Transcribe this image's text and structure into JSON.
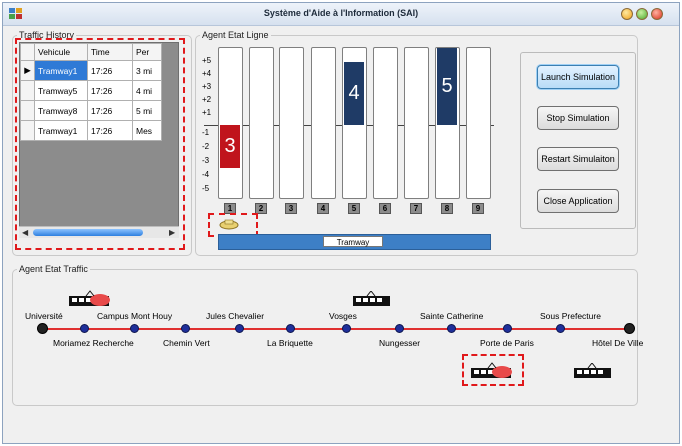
{
  "window": {
    "title": "Système d'Aide à l'Information (SAI)"
  },
  "traffic_history": {
    "legend": "Traffic History",
    "columns": [
      "Vehicule",
      "Time",
      "Per"
    ],
    "rows": [
      {
        "vehicle": "Tramway1",
        "time": "17:26",
        "per": "3 mi"
      },
      {
        "vehicle": "Tramway5",
        "time": "17:26",
        "per": "4 mi"
      },
      {
        "vehicle": "Tramway8",
        "time": "17:26",
        "per": "5 mi"
      },
      {
        "vehicle": "Tramway1",
        "time": "17:26",
        "per": "Mes"
      }
    ]
  },
  "agent_etat_ligne": {
    "legend": "Agent Etat Ligne",
    "y_ticks": [
      "+5",
      "+4",
      "+3",
      "+2",
      "+1",
      "-1",
      "-2",
      "-3",
      "-4",
      "-5"
    ],
    "columns": [
      "1",
      "2",
      "3",
      "4",
      "5",
      "6",
      "7",
      "8",
      "9"
    ],
    "bars": [
      {
        "column": "1",
        "value": -3,
        "label": "3",
        "color": "#c0141c"
      },
      {
        "column": "5",
        "value": 4,
        "label": "4",
        "color": "#1f3b66"
      },
      {
        "column": "8",
        "value": 5,
        "label": "5",
        "color": "#1f3b66"
      }
    ],
    "tramway_label": "Tramway"
  },
  "controls": {
    "launch": "Launch Simulation",
    "stop": "Stop Simulation",
    "restart": "Restart Simulaiton",
    "close": "Close Application"
  },
  "agent_etat_traffic": {
    "legend": "Agent Etat Traffic",
    "stations_top": [
      "Université",
      "Campus Mont Houy",
      "Jules Chevalier",
      "Vosges",
      "Sainte Catherine",
      "Sous Prefecture"
    ],
    "stations_bottom": [
      "Moriamez Recherche",
      "Chemin Vert",
      "La Briquette",
      "Nungesser",
      "Porte de Paris",
      "Hôtel De Ville"
    ]
  },
  "colors": {
    "line": "#e03030",
    "accent": "#3d7fc6",
    "highlight": "#e0191b"
  }
}
